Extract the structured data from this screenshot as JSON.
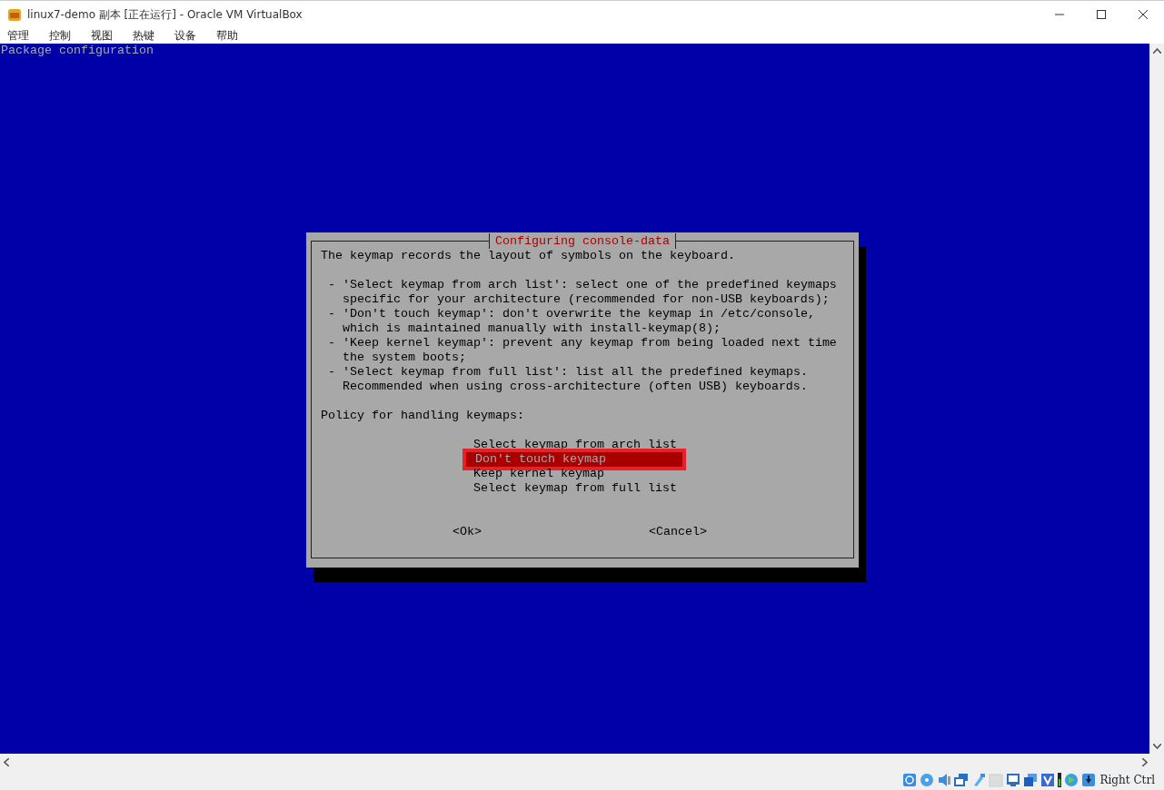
{
  "window": {
    "title": "linux7-demo 副本 [正在运行] - Oracle VM VirtualBox"
  },
  "menu": [
    "管理",
    "控制",
    "视图",
    "热键",
    "设备",
    "帮助"
  ],
  "console": {
    "header": "Package configuration",
    "dialog": {
      "title": "Configuring console-data",
      "intro": "The keymap records the layout of symbols on the keyboard.",
      "bullets": [
        "- 'Select keymap from arch list': select one of the predefined keymaps\nspecific for your architecture (recommended for non-USB keyboards);",
        "- 'Don't touch keymap': don't overwrite the keymap in /etc/console,\nwhich is maintained manually with install-keymap(8);",
        "- 'Keep kernel keymap': prevent any keymap from being loaded next time\nthe system boots;",
        "- 'Select keymap from full list': list all the predefined keymaps.\nRecommended when using cross-architecture (often USB) keyboards."
      ],
      "prompt": "Policy for handling keymaps:",
      "options": [
        {
          "label": "Select keymap from arch list",
          "selected": false
        },
        {
          "label": "Don't touch keymap",
          "selected": true
        },
        {
          "label": "Keep kernel keymap",
          "selected": false
        },
        {
          "label": "Select keymap from full list",
          "selected": false
        }
      ],
      "buttons": [
        "<Ok>",
        "<Cancel>"
      ]
    }
  },
  "status_bar": {
    "host_key": "Right Ctrl"
  }
}
